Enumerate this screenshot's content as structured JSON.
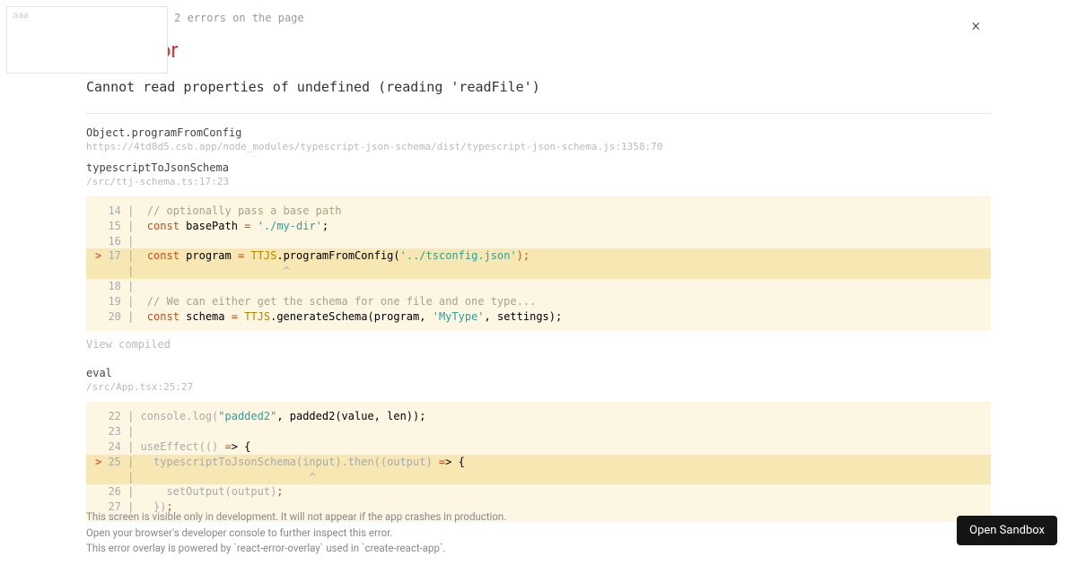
{
  "corner": "aaa",
  "nav": {
    "counter": "1 of 2 errors on the page"
  },
  "close": "×",
  "error": {
    "type": "TypeError",
    "message": "Cannot read properties of undefined (reading 'readFile')"
  },
  "frames": [
    {
      "fn": "Object.programFromConfig",
      "loc": "https://4td8d5.csb.app/node_modules/typescript-json-schema/dist/typescript-json-schema.js:1358:70"
    },
    {
      "fn": "typescriptToJsonSchema",
      "loc": "/src/ttj-schema.ts:17:23"
    }
  ],
  "code1": {
    "l14_ln": "  14 |  ",
    "l14_cmt": "// optionally pass a base path",
    "l15_ln": "  15 |  ",
    "l15_kw": "const",
    "l15_a": " basePath ",
    "l15_op": "=",
    "l15_b": " ",
    "l15_str": "'./my-dir'",
    "l15_c": ";",
    "l16": "  16 | ",
    "l17_g": "> ",
    "l17_ln": "17 |  ",
    "l17_kw": "const",
    "l17_a": " program ",
    "l17_op": "=",
    "l17_b": " ",
    "l17_cls": "TTJS",
    "l17_c": ".programFromConfig(",
    "l17_str": "'../tsconfig.json'",
    "l17_d": ");",
    "l17p": "     |                       ^",
    "l18": "  18 | ",
    "l19_ln": "  19 |  ",
    "l19_cmt": "// We can either get the schema for one file and one type...",
    "l20_ln": "  20 |  ",
    "l20_kw": "const",
    "l20_a": " schema ",
    "l20_op": "=",
    "l20_b": " ",
    "l20_cls": "TTJS",
    "l20_c": ".generateSchema(program, ",
    "l20_str": "'MyType'",
    "l20_d": ", settings);"
  },
  "view_compiled": "View compiled",
  "frame3": {
    "fn": "eval",
    "loc": "/src/App.tsx:25:27"
  },
  "code2": {
    "l22_ln": "  22 | console.log(",
    "l22_str": "\"padded2\"",
    "l22_a": ", padded2(value, len));",
    "l23": "  23 | ",
    "l24_ln": "  24 | useEffect(() ",
    "l24_op": "=",
    "l24_a": "> {",
    "l25_g": "> ",
    "l25_ln": "25 |   typescriptToJsonSchema(input).then((output) ",
    "l25_op": "=",
    "l25_a": "> {",
    "l25p": "     |                           ^",
    "l26_ln": "  26 |     setOutput(output)",
    "l26_a": ";",
    "l27_ln": "  27 |   })",
    "l27_a": ";"
  },
  "footer": {
    "l1": "This screen is visible only in development. It will not appear if the app crashes in production.",
    "l2": "Open your browser's developer console to further inspect this error.",
    "l3": "This error overlay is powered by `react-error-overlay` used in `create-react-app`."
  },
  "sandbox_btn": "Open Sandbox"
}
